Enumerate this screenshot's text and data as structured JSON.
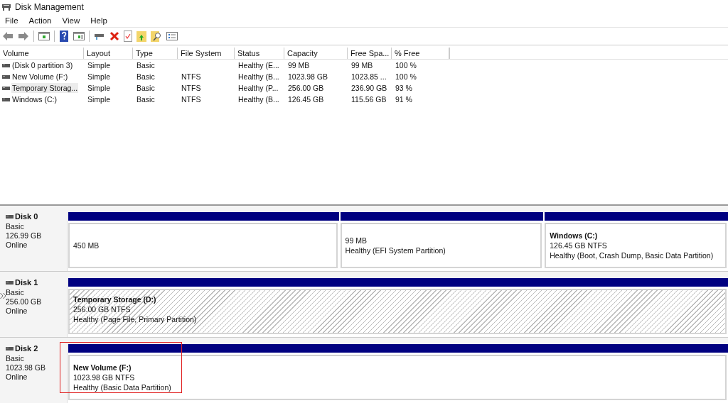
{
  "window": {
    "title": "Disk Management"
  },
  "menu": [
    "File",
    "Action",
    "View",
    "Help"
  ],
  "table": {
    "columns": [
      "Volume",
      "Layout",
      "Type",
      "File System",
      "Status",
      "Capacity",
      "Free Spa...",
      "% Free"
    ],
    "rows": [
      {
        "selected": false,
        "cells": [
          "(Disk 0 partition 3)",
          "Simple",
          "Basic",
          "",
          "Healthy (E...",
          "99 MB",
          "99 MB",
          "100 %"
        ]
      },
      {
        "selected": false,
        "cells": [
          "New Volume (F:)",
          "Simple",
          "Basic",
          "NTFS",
          "Healthy (B...",
          "1023.98 GB",
          "1023.85 ...",
          "100 %"
        ]
      },
      {
        "selected": true,
        "cells": [
          "Temporary Storag...",
          "Simple",
          "Basic",
          "NTFS",
          "Healthy (P...",
          "256.00 GB",
          "236.90 GB",
          "93 %"
        ]
      },
      {
        "selected": false,
        "cells": [
          "Windows (C:)",
          "Simple",
          "Basic",
          "NTFS",
          "Healthy (B...",
          "126.45 GB",
          "115.56 GB",
          "91 %"
        ]
      }
    ]
  },
  "disks": [
    {
      "name": "Disk 0",
      "type": "Basic",
      "size": "126.99 GB",
      "status": "Online",
      "partitions": [
        {
          "kind": "primary",
          "highlighted": false,
          "lines": [
            "450 MB"
          ]
        },
        {
          "kind": "primary",
          "highlighted": false,
          "lines": [
            "99 MB",
            "Healthy (EFI System Partition)"
          ]
        },
        {
          "kind": "primary",
          "highlighted": false,
          "title": "Windows  (C:)",
          "lines": [
            "126.45 GB NTFS",
            "Healthy (Boot, Crash Dump, Basic Data Partition)"
          ]
        }
      ]
    },
    {
      "name": "Disk 1",
      "type": "Basic",
      "size": "256.00 GB",
      "status": "Online",
      "partitions": [
        {
          "kind": "hatched",
          "highlighted": false,
          "title": "Temporary Storage  (D:)",
          "lines": [
            "256.00 GB NTFS",
            "Healthy (Page File, Primary Partition)"
          ]
        }
      ]
    },
    {
      "name": "Disk 2",
      "type": "Basic",
      "size": "1023.98 GB",
      "status": "Online",
      "partitions": [
        {
          "kind": "primary",
          "highlighted": true,
          "title": "New Volume  (F:)",
          "lines": [
            "1023.98 GB NTFS",
            "Healthy (Basic Data Partition)"
          ]
        }
      ]
    }
  ]
}
